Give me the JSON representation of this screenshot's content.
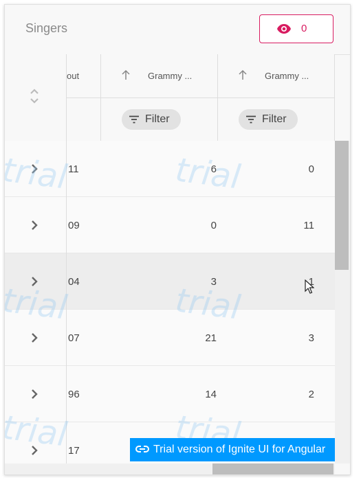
{
  "toolbar": {
    "title": "Singers",
    "hidden_columns_icon": "eye-icon",
    "hidden_count": "0",
    "accent_color": "#d81b60"
  },
  "header": {
    "collapse_icon": "collapse-all-icon",
    "columns": [
      {
        "label": "out",
        "sort_icon": "arrow-up-icon"
      },
      {
        "label": "Grammy ...",
        "sort_icon": "arrow-up-icon",
        "filter_label": "Filter"
      },
      {
        "label": "Grammy ...",
        "sort_icon": "arrow-up-icon",
        "filter_label": "Filter"
      }
    ]
  },
  "rows": [
    {
      "c1": "11",
      "c2": "6",
      "c3": "0"
    },
    {
      "c1": "09",
      "c2": "0",
      "c3": "11"
    },
    {
      "c1": "04",
      "c2": "3",
      "c3": "1"
    },
    {
      "c1": "07",
      "c2": "21",
      "c3": "3"
    },
    {
      "c1": "96",
      "c2": "14",
      "c3": "2"
    },
    {
      "c1": "17",
      "c2": "",
      "c3": ""
    }
  ],
  "watermark_text": "trial",
  "trial_banner": {
    "text": "Trial version of Ignite UI for Angular",
    "icon": "link-icon",
    "color": "#0099ff"
  }
}
